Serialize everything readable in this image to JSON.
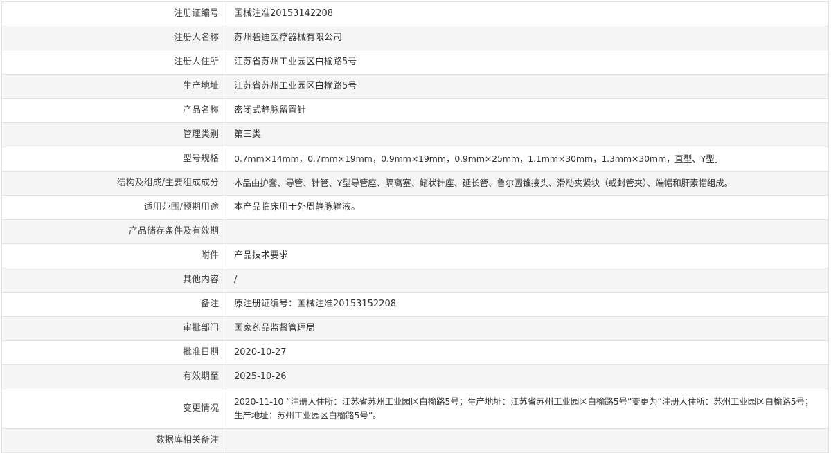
{
  "rows": [
    {
      "label": "注册证编号",
      "value": "国械注准20153142208"
    },
    {
      "label": "注册人名称",
      "value": "苏州碧迪医疗器械有限公司"
    },
    {
      "label": "注册人住所",
      "value": "江苏省苏州工业园区白榆路5号"
    },
    {
      "label": "生产地址",
      "value": "江苏省苏州工业园区白榆路5号"
    },
    {
      "label": "产品名称",
      "value": "密闭式静脉留置针"
    },
    {
      "label": "管理类别",
      "value": "第三类"
    },
    {
      "label": "型号规格",
      "value": "0.7mm×14mm，0.7mm×19mm，0.9mm×19mm，0.9mm×25mm，1.1mm×30mm，1.3mm×30mm，直型、Y型。"
    },
    {
      "label": "结构及组成/主要组成成分",
      "value": "本品由护套、导管、针管、Y型导管座、隔离塞、鳍状针座、延长管、鲁尔圆锥接头、滑动夹紧块（或封管夹）、端帽和肝素帽组成。"
    },
    {
      "label": "适用范围/预期用途",
      "value": "本产品临床用于外周静脉输液。"
    },
    {
      "label": "产品储存条件及有效期",
      "value": ""
    },
    {
      "label": "附件",
      "value": "产品技术要求"
    },
    {
      "label": "其他内容",
      "value": "/"
    },
    {
      "label": "备注",
      "value": "原注册证编号：国械注准20153152208"
    },
    {
      "label": "审批部门",
      "value": "国家药品监督管理局"
    },
    {
      "label": "批准日期",
      "value": "2020-10-27"
    },
    {
      "label": "有效期至",
      "value": "2025-10-26"
    },
    {
      "label": "变更情况",
      "value": "2020-11-10 “注册人住所：江苏省苏州工业园区白榆路5号；生产地址：江苏省苏州工业园区白榆路5号”变更为“注册人住所：苏州工业园区白榆路5号；生产地址：苏州工业园区白榆路5号”。"
    },
    {
      "label": "数据库相关备注",
      "value": ""
    }
  ]
}
